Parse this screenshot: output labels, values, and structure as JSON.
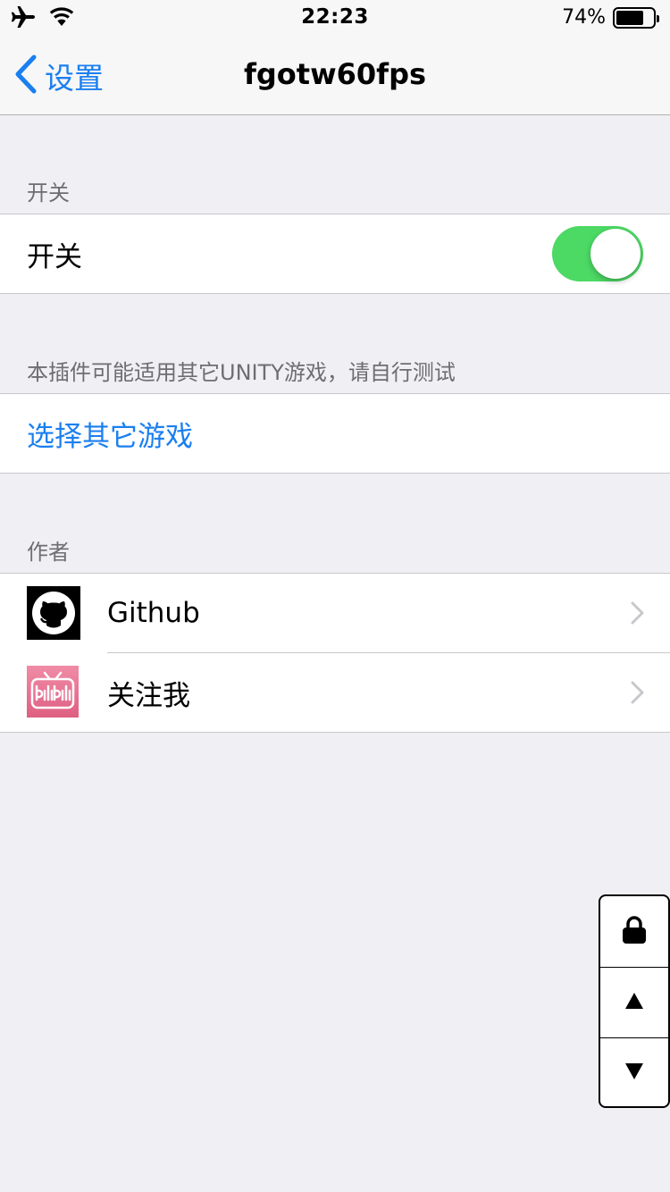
{
  "status_bar": {
    "time": "22:23",
    "battery_percent": "74%",
    "battery_level": 0.74,
    "icons": [
      "airplane-icon",
      "wifi-icon",
      "battery-icon"
    ]
  },
  "nav": {
    "back_label": "设置",
    "title": "fgotw60fps"
  },
  "sections": {
    "switch": {
      "header": "开关",
      "cell_label": "开关",
      "toggle_on": true
    },
    "games": {
      "header": "本插件可能适用其它UNITY游戏，请自行测试",
      "link_label": "选择其它游戏"
    },
    "author": {
      "header": "作者",
      "items": [
        {
          "label": "Github",
          "icon": "github-icon"
        },
        {
          "label": "关注我",
          "icon": "bilibili-icon"
        }
      ]
    }
  },
  "float_panel": {
    "buttons": [
      "lock-icon",
      "arrow-up-icon",
      "arrow-down-icon"
    ]
  },
  "colors": {
    "accent": "#1a7ff0",
    "toggle_on": "#4cd964",
    "background": "#efeff4",
    "bilibili_pink": "#e5708f"
  }
}
